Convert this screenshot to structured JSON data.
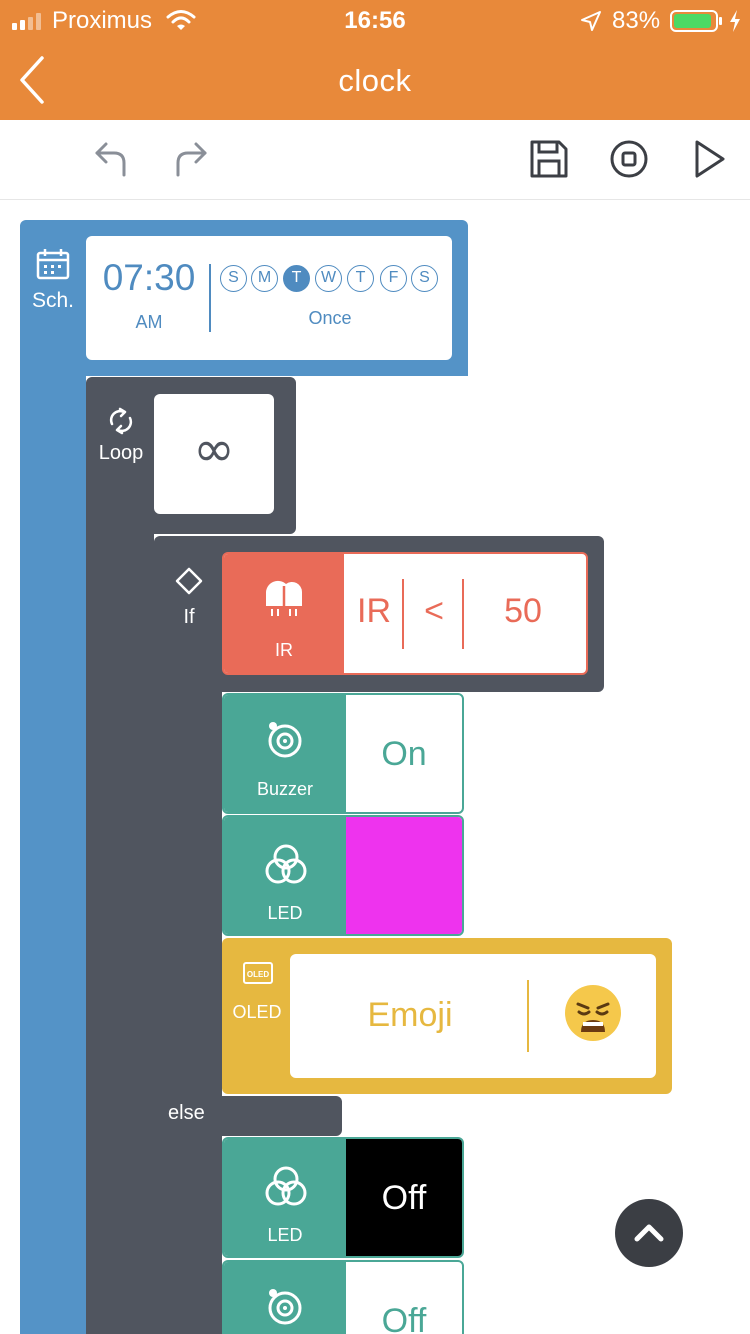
{
  "status_bar": {
    "carrier": "Proximus",
    "time": "16:56",
    "battery": "83%"
  },
  "header": {
    "title": "clock"
  },
  "toolbar": {
    "undo_icon": "undo-icon",
    "redo_icon": "redo-icon",
    "save_icon": "save-icon",
    "stop_icon": "stop-icon",
    "play_icon": "play-icon"
  },
  "schedule": {
    "label": "Sch.",
    "time": "07:30",
    "ampm": "AM",
    "days": [
      "S",
      "M",
      "T",
      "W",
      "T",
      "F",
      "S"
    ],
    "active_day_index": 2,
    "repeat": "Once"
  },
  "loop": {
    "label": "Loop",
    "value_symbol": "∞"
  },
  "if_block": {
    "label": "If",
    "sensor_label": "IR",
    "operand": "IR",
    "operator": "<",
    "threshold": "50"
  },
  "then_actions": {
    "buzzer": {
      "label": "Buzzer",
      "value": "On"
    },
    "led": {
      "label": "LED",
      "color": "#EE33EE"
    },
    "oled": {
      "label": "OLED",
      "icon_text": "OLED",
      "mode": "Emoji",
      "emoji": "😩"
    }
  },
  "else_block": {
    "label": "else",
    "led": {
      "label": "LED",
      "value": "Off",
      "color": "#000000"
    },
    "buzzer": {
      "value": "Off"
    }
  },
  "colors": {
    "header": "#E8893A",
    "schedule": "#5493C7",
    "control": "#50555F",
    "sensor": "#E96B58",
    "actuator": "#4AA796",
    "display": "#E6B840"
  }
}
